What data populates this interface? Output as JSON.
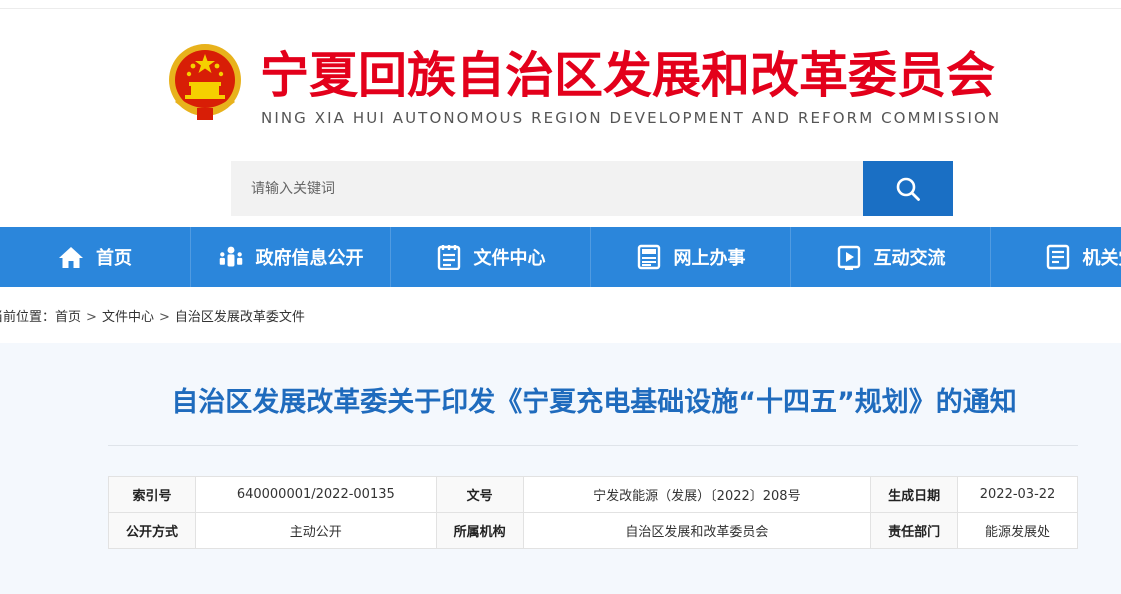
{
  "header": {
    "title": "宁夏回族自治区发展和改革委员会",
    "subtitle": "NING XIA HUI AUTONOMOUS REGION DEVELOPMENT AND REFORM COMMISSION"
  },
  "search": {
    "placeholder": "请输入关键词"
  },
  "nav": {
    "items": [
      {
        "label": "首页",
        "icon": "home-icon"
      },
      {
        "label": "政府信息公开",
        "icon": "people-icon"
      },
      {
        "label": "文件中心",
        "icon": "document-icon"
      },
      {
        "label": "网上办事",
        "icon": "news-icon"
      },
      {
        "label": "互动交流",
        "icon": "play-icon"
      },
      {
        "label": "机关党",
        "icon": "list-icon"
      }
    ]
  },
  "breadcrumb": {
    "prefix": "当前位置：",
    "items": [
      "首页",
      "文件中心",
      "自治区发展改革委文件"
    ],
    "separator": ">"
  },
  "document": {
    "title": "自治区发展改革委关于印发《宁夏充电基础设施“十四五”规划》的通知",
    "info": {
      "row1": {
        "index_label": "索引号",
        "index_value": "640000001/2022-00135",
        "docno_label": "文号",
        "docno_value": "宁发改能源（发展）〔2022〕208号",
        "date_label": "生成日期",
        "date_value": "2022-03-22"
      },
      "row2": {
        "open_label": "公开方式",
        "open_value": "主动公开",
        "org_label": "所属机构",
        "org_value": "自治区发展和改革委员会",
        "dept_label": "责任部门",
        "dept_value": "能源发展处"
      }
    }
  },
  "colors": {
    "brand_red": "#e3001b",
    "nav_blue": "#2b86db",
    "search_blue": "#1a6fc4",
    "title_blue": "#1f6bbd",
    "panel_bg": "#f4f8fd"
  }
}
